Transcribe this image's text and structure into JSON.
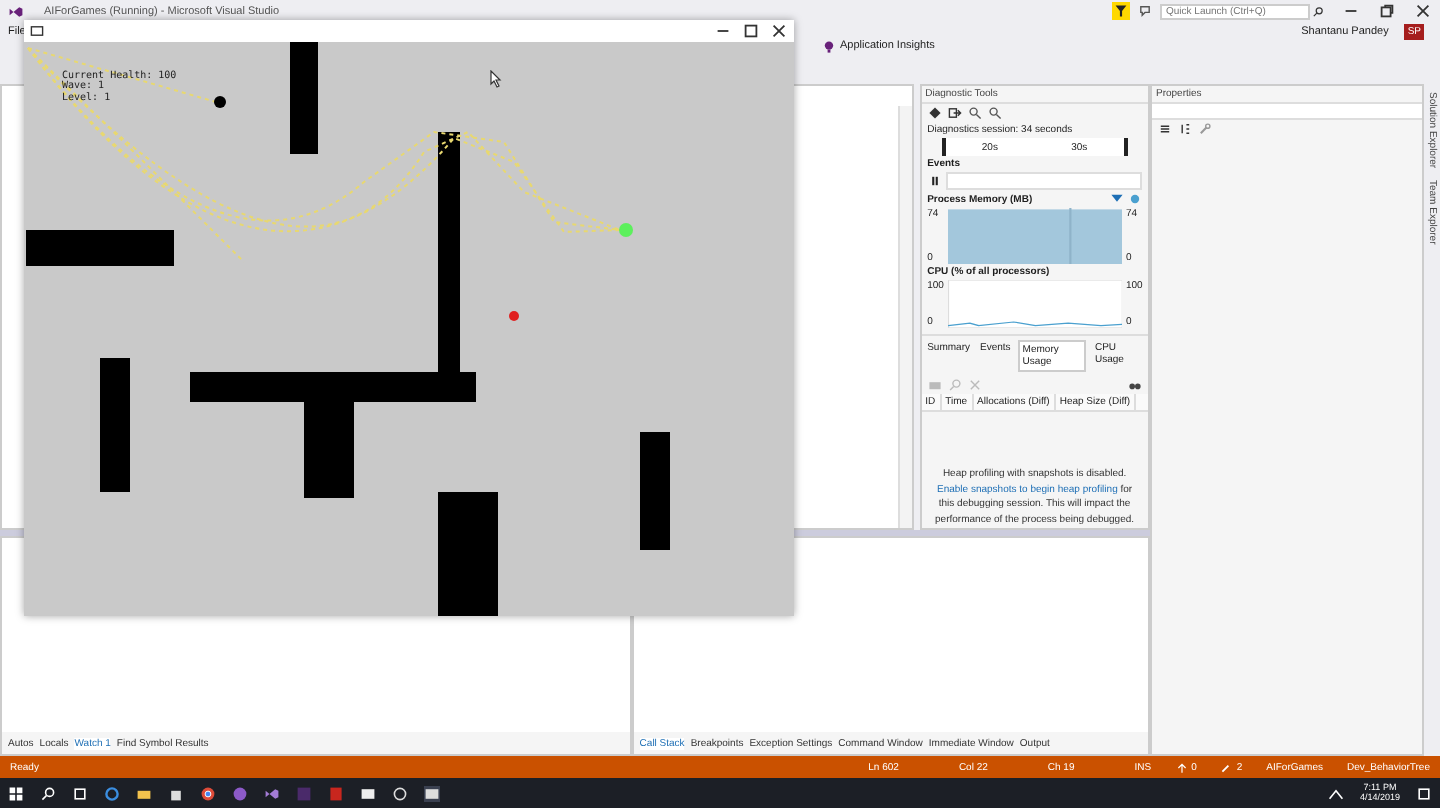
{
  "vs_window": {
    "title": "AIForGames (Running) - Microsoft Visual Studio",
    "menu": [
      "File"
    ],
    "quick_launch": {
      "placeholder": "Quick Launch (Ctrl+Q)"
    },
    "user": {
      "name": "Shantanu Pandey",
      "initials": "SP"
    },
    "toolbar": {
      "application_insights": "Application Insights"
    }
  },
  "game_window": {
    "hud": [
      "Current Health: 100",
      "Wave: 1",
      "Level: 1"
    ]
  },
  "diagnostic_tools": {
    "title": "Diagnostic Tools",
    "session": "Diagnostics session: 34 seconds",
    "timeline_labels": [
      "20s",
      "30s"
    ],
    "events_label": "Events",
    "memory_label": "Process Memory (MB)",
    "memory_axis": [
      "74",
      "0",
      "74",
      "0"
    ],
    "cpu_label": "CPU (% of all processors)",
    "cpu_axis": [
      "100",
      "0",
      "100",
      "0"
    ],
    "tabs": [
      {
        "label": "Summary",
        "selected": false
      },
      {
        "label": "Events",
        "selected": false
      },
      {
        "label": "Memory Usage",
        "selected": true
      },
      {
        "label": "CPU Usage",
        "selected": false
      }
    ],
    "columns": [
      "ID",
      "Time",
      "Allocations (Diff)",
      "Heap Size (Diff)"
    ],
    "message": {
      "line1": "Heap profiling with snapshots is disabled.",
      "link": "Enable snapshots to begin heap profiling",
      "rest": "for this debugging session. This will impact the performance of the process being debugged."
    }
  },
  "properties": {
    "title": "Properties"
  },
  "side_tabs": [
    "Solution Explorer",
    "Team Explorer"
  ],
  "watch_panel": {
    "tabs": [
      {
        "label": "Autos",
        "selected": false
      },
      {
        "label": "Locals",
        "selected": false
      },
      {
        "label": "Watch 1",
        "selected": true
      },
      {
        "label": "Find Symbol Results",
        "selected": false
      }
    ]
  },
  "call_stack_panel": {
    "tabs": [
      {
        "label": "Call Stack",
        "selected": true
      },
      {
        "label": "Breakpoints",
        "selected": false
      },
      {
        "label": "Exception Settings",
        "selected": false
      },
      {
        "label": "Command Window",
        "selected": false
      },
      {
        "label": "Immediate Window",
        "selected": false
      },
      {
        "label": "Output",
        "selected": false
      }
    ]
  },
  "status_bar": {
    "text": "Ready",
    "line": "Ln 602",
    "col": "Col 22",
    "ch": "Ch 19",
    "mode": "INS",
    "pushes": "0",
    "changes": "2",
    "repo": "AIForGames",
    "branch": "Dev_BehaviorTree"
  },
  "taskbar": {
    "time": "7:11 PM",
    "date": "4/14/2019"
  }
}
